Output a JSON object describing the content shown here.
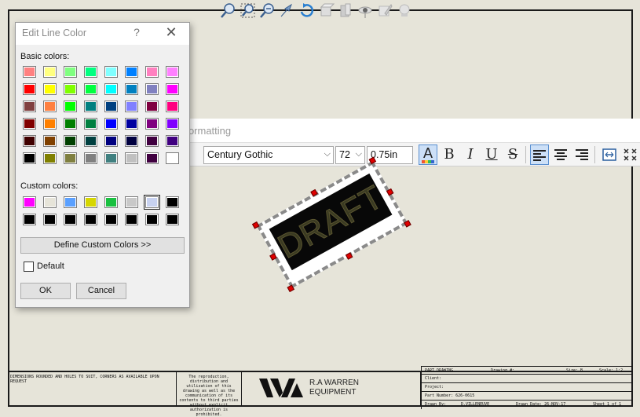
{
  "top_toolbar": {
    "icons": [
      "zoom-to-fit-icon",
      "zoom-to-area-icon",
      "zoom-in-out-icon",
      "select-icon",
      "rotate-view-icon",
      "view-orientation-icon",
      "display-style-icon",
      "hide-show-icon",
      "edit-appearance-icon",
      "apply-scene-icon"
    ]
  },
  "dialog": {
    "title": "Edit Line Color",
    "help_glyph": "?",
    "close_glyph": "✕",
    "basic_colors_label": "Basic colors:",
    "basic_colors": [
      [
        "#ff8080",
        "#ffff80",
        "#80ff80",
        "#00ff80",
        "#80ffff",
        "#0080ff",
        "#ff80c0",
        "#ff80ff"
      ],
      [
        "#ff0000",
        "#ffff00",
        "#80ff00",
        "#00ff40",
        "#00ffff",
        "#0080c0",
        "#8080c0",
        "#ff00ff"
      ],
      [
        "#804040",
        "#ff8040",
        "#00ff00",
        "#008080",
        "#004080",
        "#8080ff",
        "#800040",
        "#ff0080"
      ],
      [
        "#800000",
        "#ff8000",
        "#008000",
        "#008040",
        "#0000ff",
        "#0000a0",
        "#800080",
        "#8000ff"
      ],
      [
        "#400000",
        "#804000",
        "#004000",
        "#004040",
        "#000080",
        "#000040",
        "#400040",
        "#400080"
      ],
      [
        "#000000",
        "#808000",
        "#808040",
        "#808080",
        "#408080",
        "#c0c0c0",
        "#400040",
        "#ffffff"
      ]
    ],
    "custom_colors_label": "Custom colors:",
    "custom_colors": [
      [
        "#ff00ff",
        "#e6e4d9",
        "#5aa0ff",
        "#d6d600",
        "#19c040",
        "#c8c8c8",
        "#c8d2f0",
        "#000000"
      ],
      [
        "#000000",
        "#000000",
        "#000000",
        "#000000",
        "#000000",
        "#000000",
        "#000000",
        "#000000"
      ]
    ],
    "selected_custom_index": 6,
    "define_custom_label": "Define Custom Colors >>",
    "default_label": "Default",
    "default_checked": false,
    "ok_label": "OK",
    "cancel_label": "Cancel"
  },
  "formatting": {
    "title": "Formatting",
    "font": "Century Gothic",
    "size": "72",
    "height": "0.75in",
    "buttons": {
      "color": "A",
      "bold": "B",
      "italic": "I",
      "underline": "U",
      "strike": "S"
    }
  },
  "stamp": {
    "text": "DRAFT"
  },
  "title_block": {
    "tolerance_note": "DIMENSIONS ROUNDED AND HOLES TO SUIT, CORNERS AS AVAILABLE UPON REQUEST",
    "proprietary_note": "The reproduction, distribution and utilization of this drawing as well as the communication of its contents to third parties without explicit authorization is prohibited.",
    "company_line1": "R.A WARREN",
    "company_line2": "EQUIPMENT",
    "drawing_type": "PART DRAWING",
    "drawing_no_label": "Drawing #:",
    "size_label": "Size: B",
    "scale_label": "Scale: 1:2",
    "client_label": "Client:",
    "project_label": "Project:",
    "part_number_label": "Part Number: 626-0615",
    "drawn_by_label": "Drawn By:",
    "drawn_by": "D.VILLENEUVE",
    "drawn_date": "Drawn Date: 26-NOV-17",
    "sheet": "Sheet 1 of 1"
  }
}
